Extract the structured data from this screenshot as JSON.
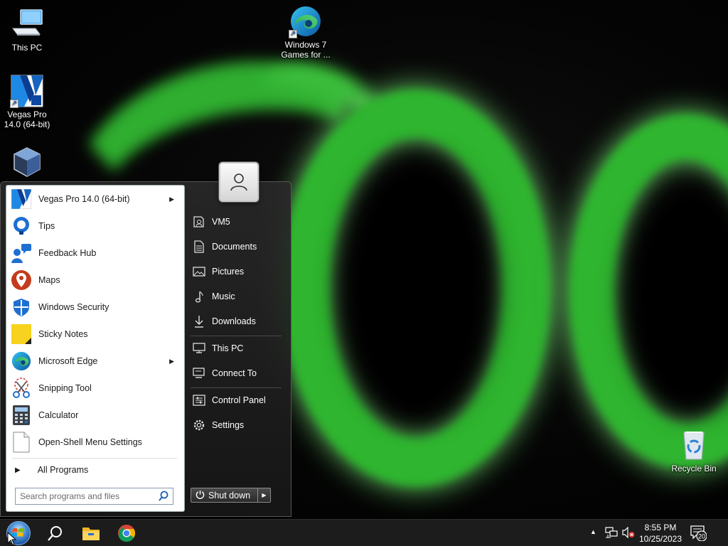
{
  "desktop": {
    "icons": [
      {
        "label": "This PC",
        "icon": "computer-icon"
      },
      {
        "label": "Vegas Pro 14.0 (64-bit)",
        "icon": "vegas-pro-icon"
      },
      {
        "label": "Windows 7 Games for ...",
        "icon": "edge-icon"
      },
      {
        "label": "Recycle Bin",
        "icon": "recycle-bin-icon"
      }
    ]
  },
  "start_menu": {
    "programs": [
      {
        "label": "Vegas Pro 14.0 (64-bit)",
        "icon": "vegas-pro-icon",
        "submenu": true
      },
      {
        "label": "Tips",
        "icon": "tips-bulb-icon",
        "submenu": false
      },
      {
        "label": "Feedback Hub",
        "icon": "feedback-hub-icon",
        "submenu": false
      },
      {
        "label": "Maps",
        "icon": "maps-pin-icon",
        "submenu": false
      },
      {
        "label": "Windows Security",
        "icon": "shield-icon",
        "submenu": false
      },
      {
        "label": "Sticky Notes",
        "icon": "sticky-notes-icon",
        "submenu": false
      },
      {
        "label": "Microsoft Edge",
        "icon": "edge-icon",
        "submenu": true
      },
      {
        "label": "Snipping Tool",
        "icon": "scissors-icon",
        "submenu": false
      },
      {
        "label": "Calculator",
        "icon": "calculator-icon",
        "submenu": false
      },
      {
        "label": "Open-Shell Menu Settings",
        "icon": "document-icon",
        "submenu": false
      }
    ],
    "all_programs": "All Programs",
    "search_placeholder": "Search programs and files",
    "places": [
      {
        "label": "VM5",
        "icon": "user-folder-icon"
      },
      {
        "label": "Documents",
        "icon": "documents-icon"
      },
      {
        "label": "Pictures",
        "icon": "pictures-icon"
      },
      {
        "label": "Music",
        "icon": "music-icon"
      },
      {
        "label": "Downloads",
        "icon": "downloads-icon"
      },
      {
        "label": "This PC",
        "icon": "computer-icon"
      },
      {
        "label": "Connect To",
        "icon": "connect-to-icon"
      },
      {
        "label": "Control Panel",
        "icon": "control-panel-icon"
      },
      {
        "label": "Settings",
        "icon": "gear-icon"
      }
    ],
    "shutdown_label": "Shut down"
  },
  "taskbar": {
    "pinned": [
      "search-icon",
      "file-explorer-icon",
      "chrome-icon"
    ],
    "clock_time": "8:55 PM",
    "clock_date": "10/25/2023",
    "notification_count": "20"
  },
  "colors": {
    "wallpaper_green": "#2fb52f",
    "taskbar": "#1c1c1c",
    "start_menu_dark": "#262626"
  }
}
